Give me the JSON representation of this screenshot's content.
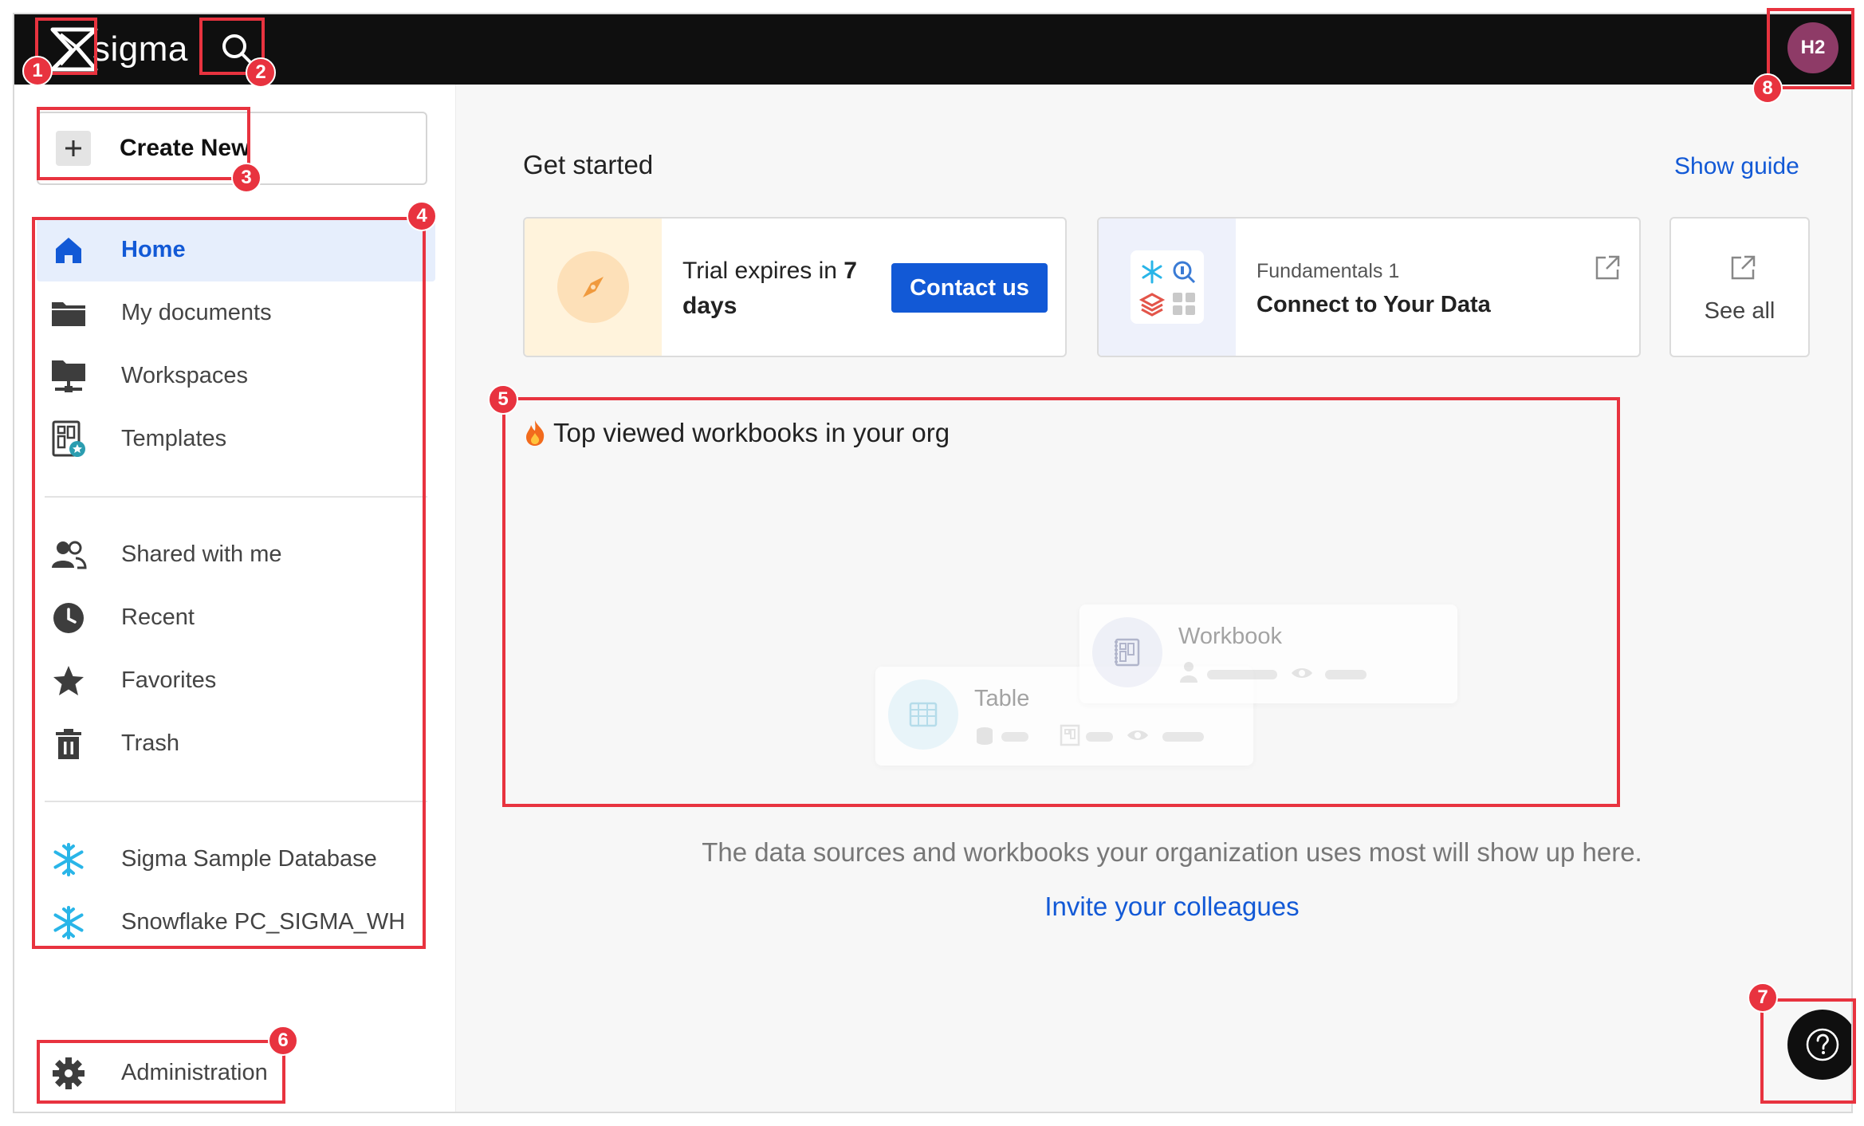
{
  "brand": {
    "name": "sigma"
  },
  "user": {
    "initials": "H2",
    "avatar_color": "#8e3b67"
  },
  "sidebar": {
    "create_label": "Create New",
    "items": [
      {
        "label": "Home",
        "icon": "home-icon",
        "active": true
      },
      {
        "label": "My documents",
        "icon": "folder-icon"
      },
      {
        "label": "Workspaces",
        "icon": "workspace-icon"
      },
      {
        "label": "Templates",
        "icon": "templates-icon"
      },
      {
        "label": "Shared with me",
        "icon": "people-icon"
      },
      {
        "label": "Recent",
        "icon": "clock-icon"
      },
      {
        "label": "Favorites",
        "icon": "star-icon"
      },
      {
        "label": "Trash",
        "icon": "trash-icon"
      },
      {
        "label": "Sigma Sample Database",
        "icon": "snowflake-icon"
      },
      {
        "label": "Snowflake PC_SIGMA_WH",
        "icon": "snowflake-icon"
      }
    ],
    "admin_label": "Administration"
  },
  "main": {
    "get_started": "Get started",
    "show_guide": "Show guide",
    "trial": {
      "text_prefix": "Trial expires in ",
      "days_number": "7",
      "text_suffix": "days",
      "contact_label": "Contact us"
    },
    "fundamentals": {
      "subtitle": "Fundamentals 1",
      "title": "Connect to Your Data"
    },
    "see_all": "See all",
    "top_viewed_title": "Top viewed workbooks in your org",
    "placeholder": {
      "table_label": "Table",
      "workbook_label": "Workbook"
    },
    "empty_message": "The data sources and workbooks your organization uses most will show up here.",
    "invite_label": "Invite your colleagues"
  },
  "annotations": [
    "1",
    "2",
    "3",
    "4",
    "5",
    "6",
    "7",
    "8"
  ],
  "colors": {
    "accent": "#1259d6",
    "annotation": "#e8333f",
    "topbar": "#0f0f0f",
    "snowflake": "#29b5e8"
  }
}
